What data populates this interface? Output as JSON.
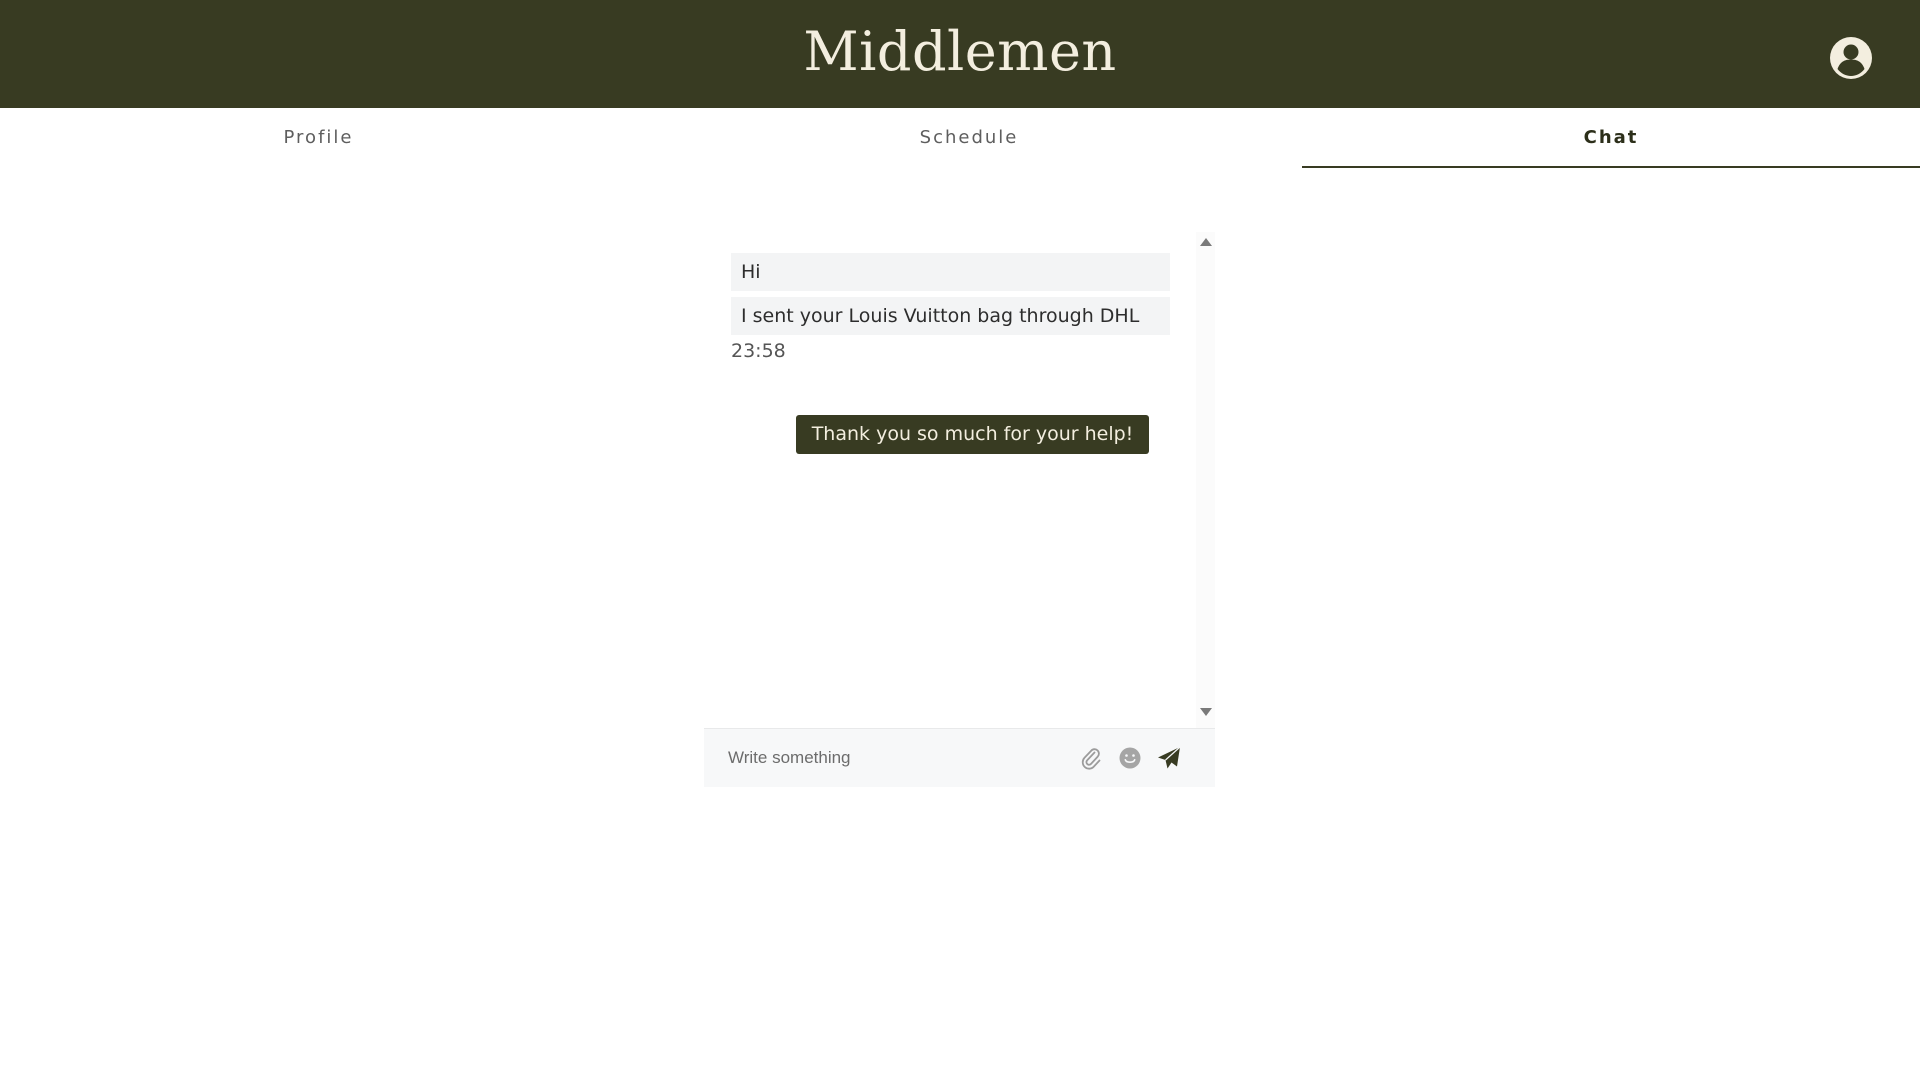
{
  "header": {
    "brand": "Middlemen",
    "account_icon": "account-circle-icon",
    "background_color": "#383b22",
    "text_color": "#f3eedf"
  },
  "tabs": [
    {
      "label": "Profile",
      "active": false
    },
    {
      "label": "Schedule",
      "active": false
    },
    {
      "label": "Chat",
      "active": true
    }
  ],
  "chat": {
    "incoming": [
      {
        "text": "Hi"
      },
      {
        "text": "I sent your Louis Vuitton bag through DHL"
      }
    ],
    "incoming_time": "23:58",
    "outgoing": [
      {
        "text": "Thank you so much for your help!"
      }
    ],
    "composer": {
      "placeholder": "Write something",
      "value": "",
      "icons": [
        "paperclip-icon",
        "emoji-icon",
        "send-icon"
      ]
    }
  }
}
